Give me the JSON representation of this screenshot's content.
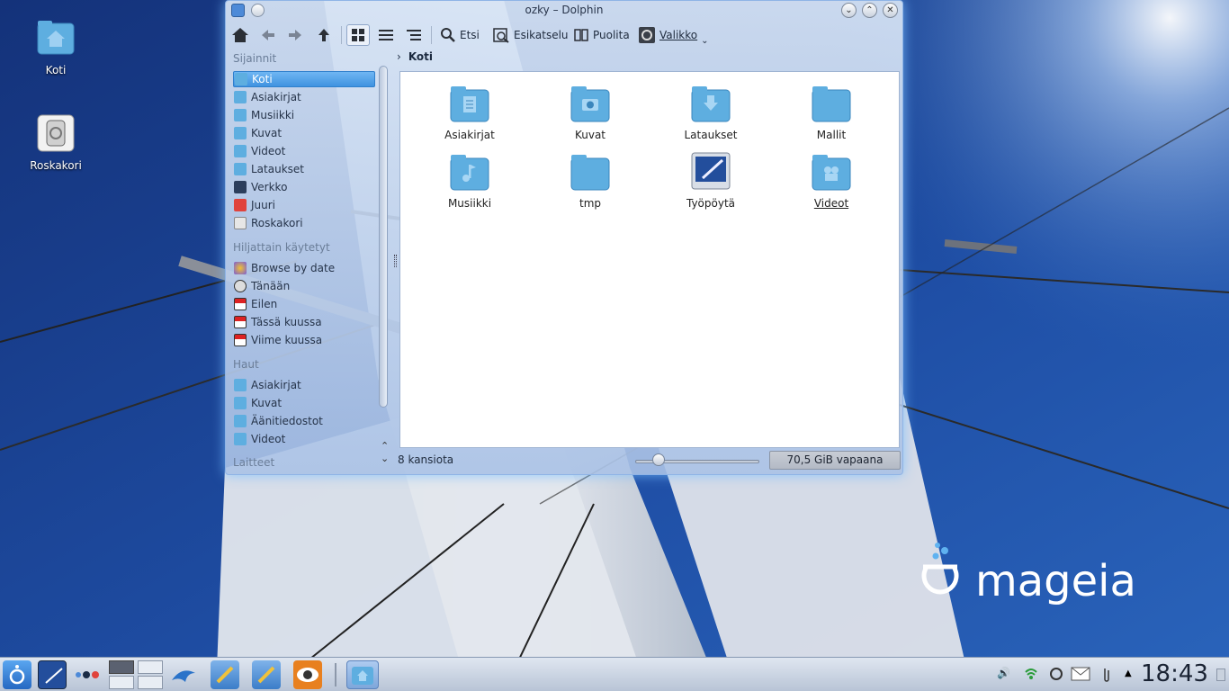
{
  "desktop": {
    "icons": [
      {
        "label": "Koti"
      },
      {
        "label": "Roskakori"
      }
    ],
    "logo_text": "mageia"
  },
  "window": {
    "title": "ozky – Dolphin",
    "toolbar": {
      "search": "Etsi",
      "preview": "Esikatselu",
      "split": "Puolita",
      "menu": "Valikko"
    },
    "places": {
      "sections": {
        "locations": "Sijainnit",
        "recent": "Hiljattain käytetyt",
        "searches": "Haut",
        "devices": "Laitteet"
      },
      "locations": [
        "Koti",
        "Asiakirjat",
        "Musiikki",
        "Kuvat",
        "Videot",
        "Lataukset",
        "Verkko",
        "Juuri",
        "Roskakori"
      ],
      "recent": [
        "Browse by date",
        "Tänään",
        "Eilen",
        "Tässä kuussa",
        "Viime kuussa"
      ],
      "searches": [
        "Asiakirjat",
        "Kuvat",
        "Äänitiedostot",
        "Videot"
      ]
    },
    "breadcrumb": "Koti",
    "files": [
      {
        "name": "Asiakirjat",
        "icon": "documents-folder-icon"
      },
      {
        "name": "Kuvat",
        "icon": "pictures-folder-icon"
      },
      {
        "name": "Lataukset",
        "icon": "downloads-folder-icon"
      },
      {
        "name": "Mallit",
        "icon": "folder-icon"
      },
      {
        "name": "Musiikki",
        "icon": "music-folder-icon"
      },
      {
        "name": "tmp",
        "icon": "folder-icon"
      },
      {
        "name": "Työpöytä",
        "icon": "desktop-folder-icon"
      },
      {
        "name": "Videot",
        "icon": "videos-folder-icon"
      }
    ],
    "status": {
      "summary": "8 kansiota",
      "free_space": "70,5 GiB vapaana"
    }
  },
  "taskbar": {
    "clock": "18:43"
  },
  "colors": {
    "folder": "#5eaee0",
    "selection": "#3f93e0",
    "wallpaper_sky": "#1c3f8c"
  }
}
